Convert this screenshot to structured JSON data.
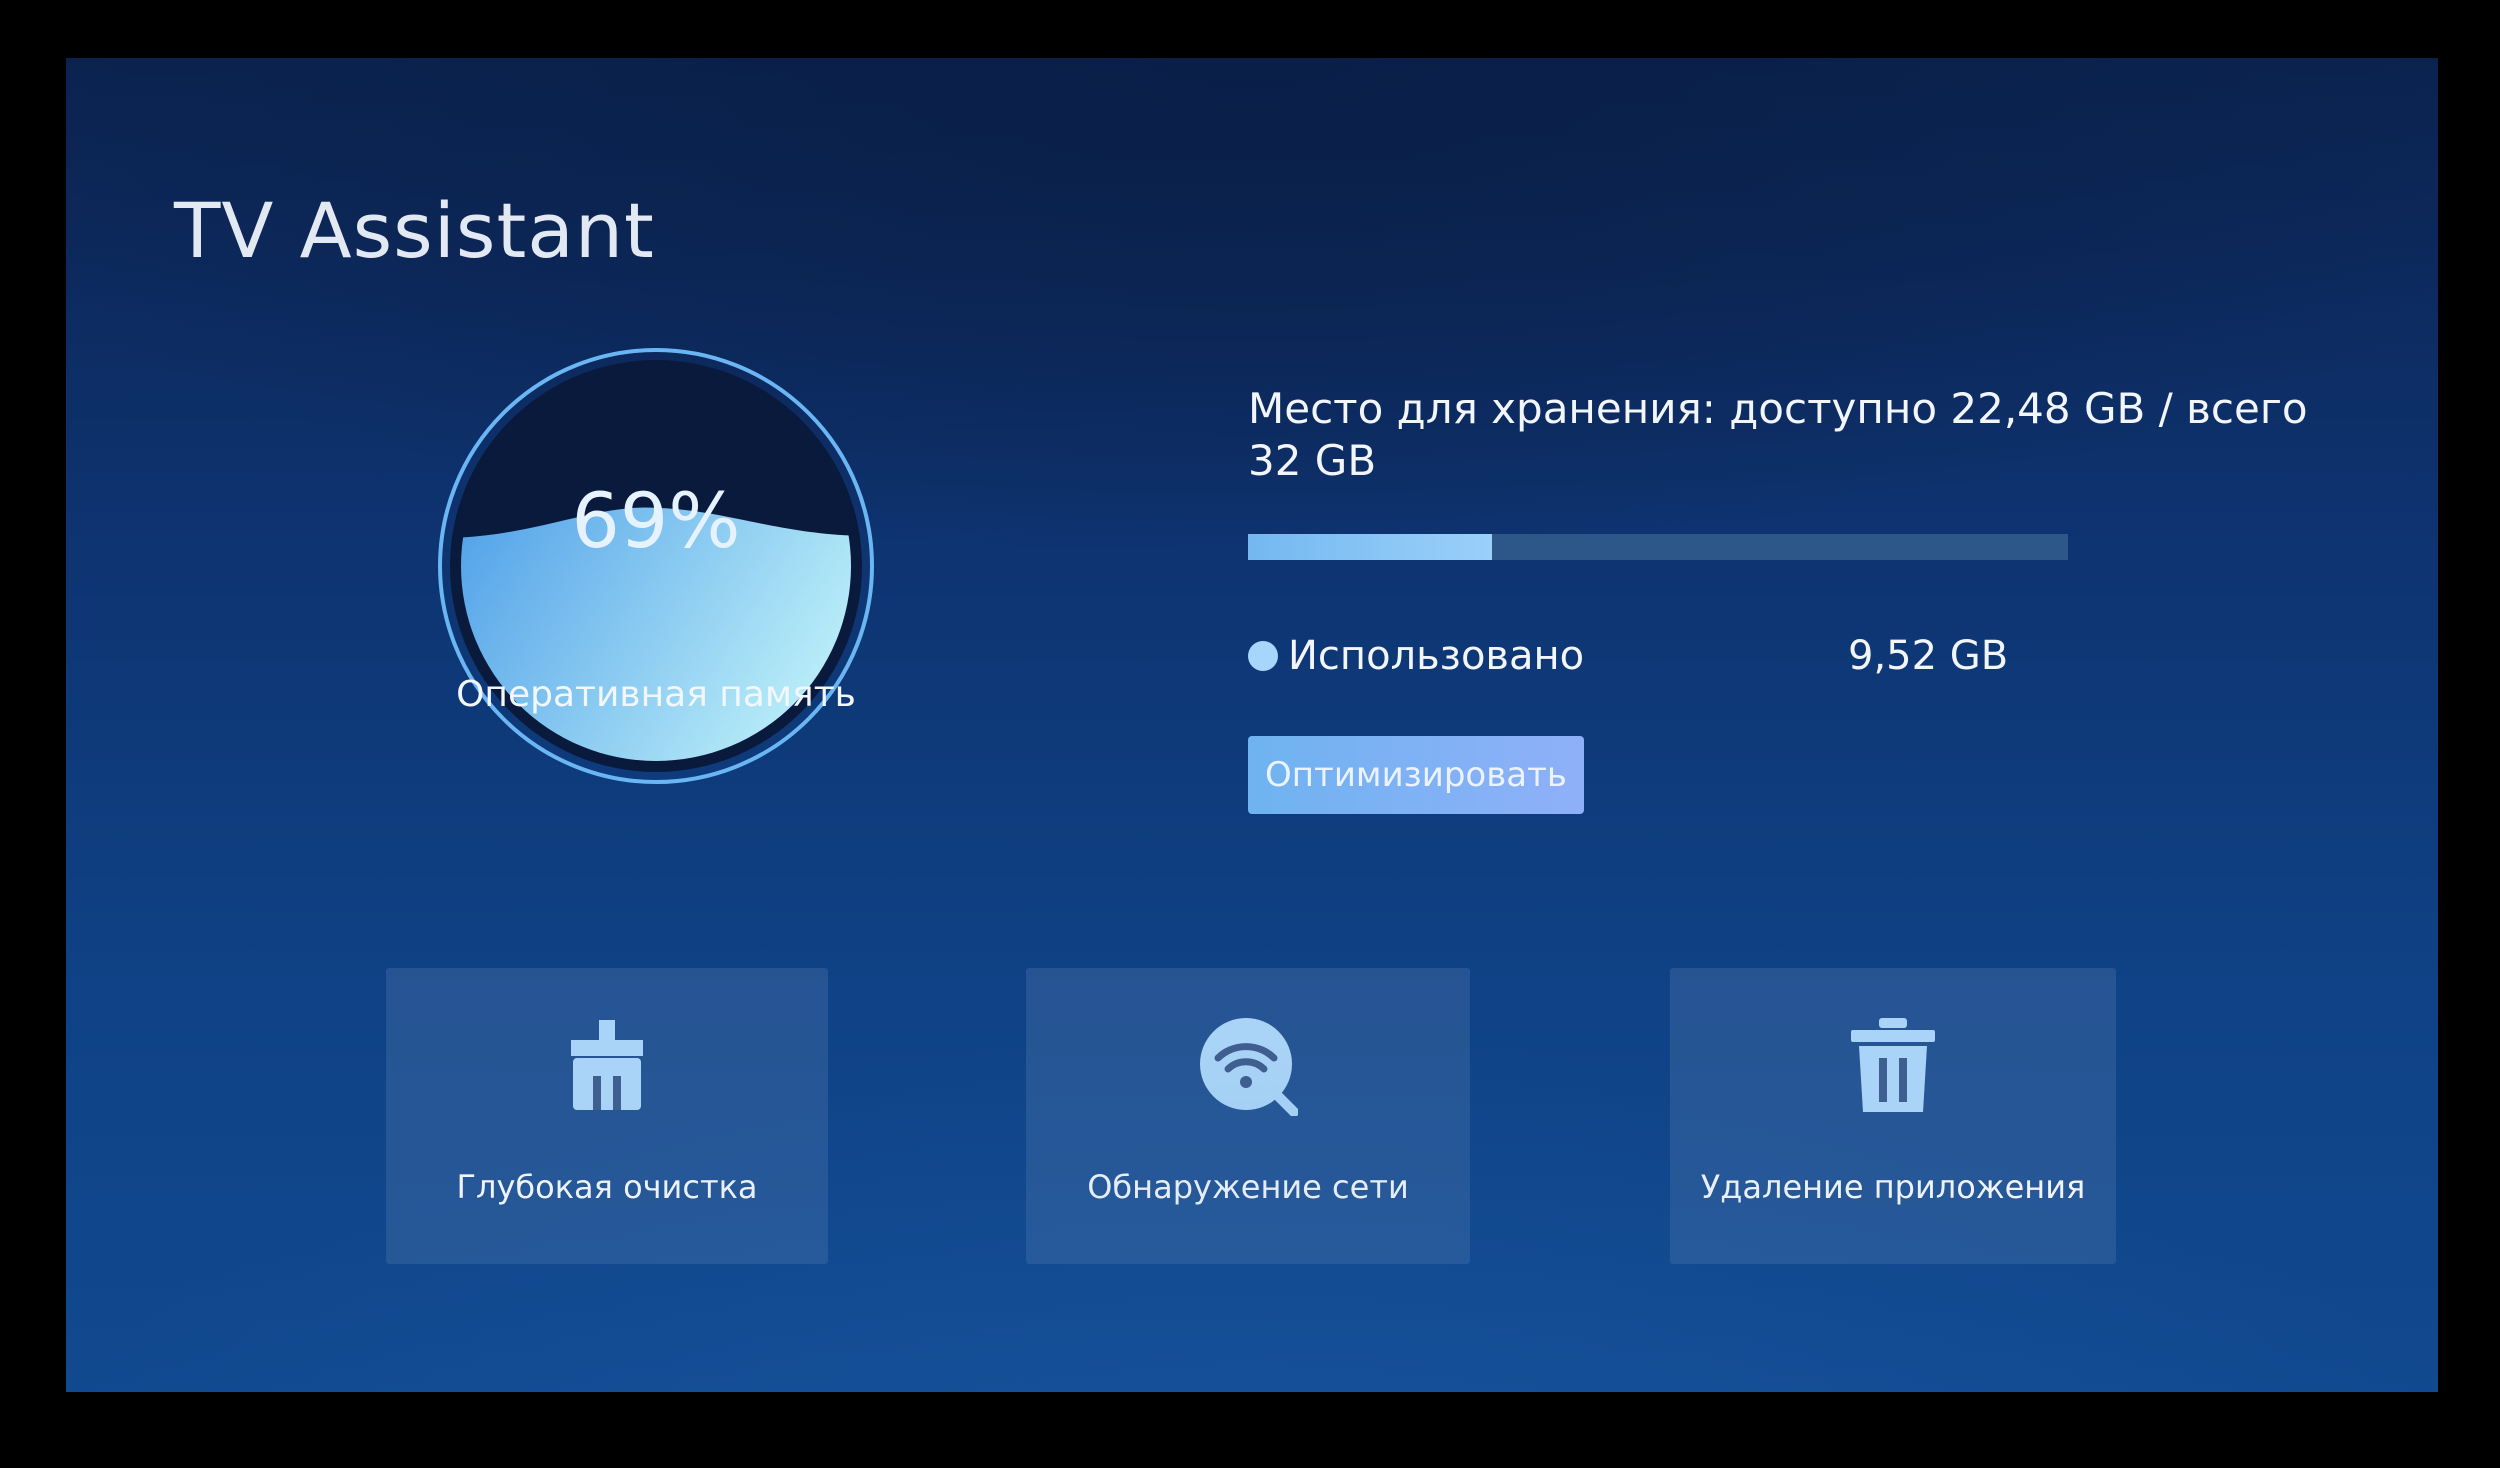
{
  "app": {
    "title": "TV Assistant"
  },
  "memory": {
    "percent_text": "69%",
    "percent_value": 69,
    "label": "Оперативная память"
  },
  "storage": {
    "title": "Место для хранения: доступно  22,48 GB / всего 32 GB",
    "used_fraction": 0.2975,
    "legend": {
      "label": "Использовано",
      "value": "9,52 GB"
    },
    "optimize_label": "Оптимизировать"
  },
  "tiles": [
    {
      "label": "Глубокая очистка",
      "icon": "broom-cleaner-icon"
    },
    {
      "label": "Обнаружение сети",
      "icon": "wifi-search-icon"
    },
    {
      "label": "Удаление приложения",
      "icon": "trash-icon"
    }
  ],
  "colors": {
    "accent": "#7bbcf2",
    "button_gradient_start": "#6fb3f1",
    "button_gradient_end": "#8fb0f8",
    "ring": "#6ab6f4",
    "icon": "#a9d4f7"
  }
}
